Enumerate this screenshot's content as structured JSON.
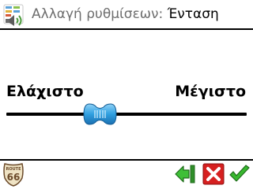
{
  "header": {
    "title_prefix": "Αλλαγή ρυθμίσεων:",
    "title_value": "Ένταση",
    "icon": "settings-volume-icon"
  },
  "slider": {
    "min_label": "Ελάχιστο",
    "max_label": "Μέγιστο",
    "value_fraction": 0.39
  },
  "footer": {
    "logo_top": "ROUTE",
    "logo_number": "66",
    "back_icon": "back-arrow-icon",
    "cancel_icon": "cancel-icon",
    "ok_icon": "ok-checkmark-icon"
  },
  "colors": {
    "thumb": "#2f9fe0",
    "back": "#35b52f",
    "cancel": "#d62020",
    "ok": "#38b82f"
  }
}
